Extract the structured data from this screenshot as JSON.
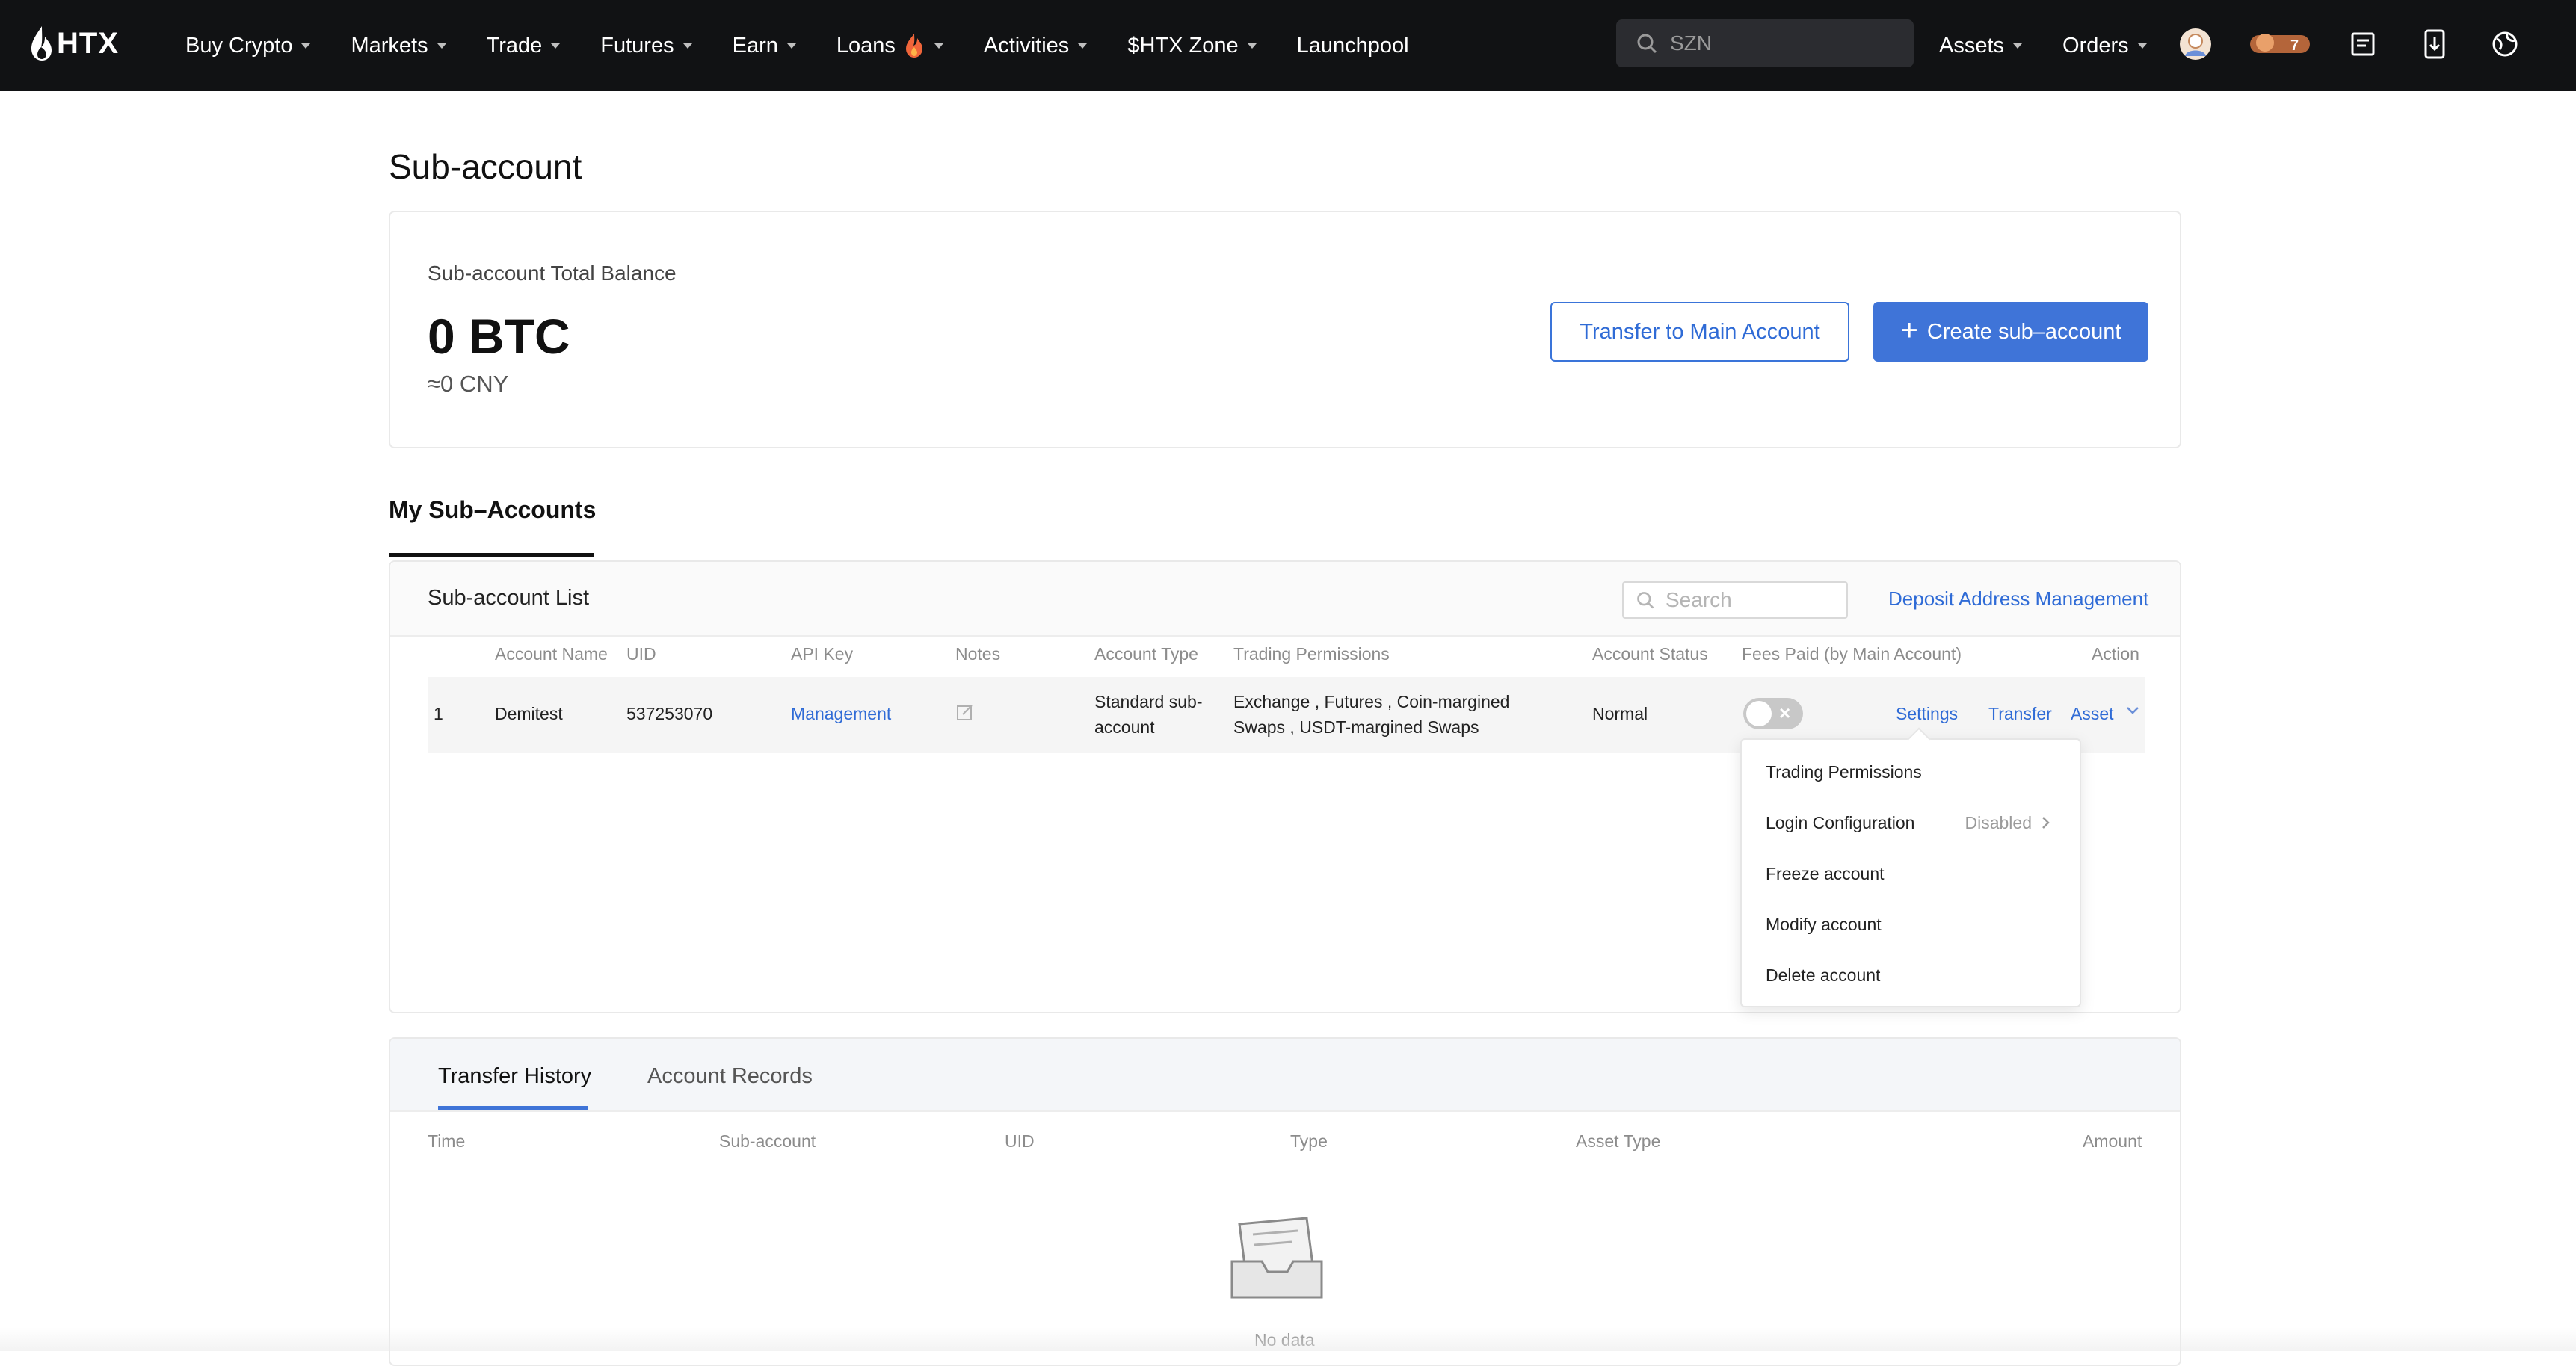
{
  "nav": {
    "brand": "HTX",
    "menu": [
      {
        "label": "Buy Crypto",
        "dropdown": true
      },
      {
        "label": "Markets",
        "dropdown": true
      },
      {
        "label": "Trade",
        "dropdown": true
      },
      {
        "label": "Futures",
        "dropdown": true
      },
      {
        "label": "Earn",
        "dropdown": true
      },
      {
        "label": "Loans",
        "dropdown": true,
        "icon": "flame-icon"
      },
      {
        "label": "Activities",
        "dropdown": true
      },
      {
        "label": "$HTX Zone",
        "dropdown": true
      },
      {
        "label": "Launchpool",
        "dropdown": false
      }
    ],
    "search_placeholder": "SZN",
    "assets_label": "Assets",
    "orders_label": "Orders",
    "badge_count": "7",
    "icons": [
      "avatar-icon",
      "badge-icon",
      "notes-icon",
      "download-icon",
      "language-icon"
    ]
  },
  "page": {
    "title": "Sub-account"
  },
  "balance": {
    "label": "Sub-account Total Balance",
    "value": "0 BTC",
    "approx": "≈0 CNY",
    "transfer_button": "Transfer to Main Account",
    "create_button": "Create sub–account"
  },
  "tabs": {
    "my_subaccounts": "My Sub–Accounts"
  },
  "list": {
    "title": "Sub-account List",
    "search_placeholder": "Search",
    "deposit_link": "Deposit Address Management",
    "columns": [
      "Account Name",
      "UID",
      "API Key",
      "Notes",
      "Account Type",
      "Trading Permissions",
      "Account Status",
      "Fees Paid (by Main Account)",
      "Action"
    ],
    "rows": [
      {
        "index": "1",
        "name": "Demitest",
        "uid": "537253070",
        "api_key": "Management",
        "account_type_line1": "Standard sub-",
        "account_type_line2": "account",
        "permissions_line1": "Exchange , Futures , Coin-margined",
        "permissions_line2": "Swaps , USDT-margined Swaps",
        "status": "Normal",
        "fees_toggle": false,
        "actions": {
          "settings": "Settings",
          "transfer": "Transfer",
          "asset": "Asset"
        }
      }
    ]
  },
  "settings_menu": {
    "items": [
      {
        "label": "Trading Permissions"
      },
      {
        "label": "Login Configuration",
        "status": "Disabled"
      },
      {
        "label": "Freeze account"
      },
      {
        "label": "Modify account"
      },
      {
        "label": "Delete account"
      }
    ]
  },
  "history": {
    "tabs": [
      "Transfer History",
      "Account Records"
    ],
    "active_tab": "Transfer History",
    "columns": [
      "Time",
      "Sub-account",
      "UID",
      "Type",
      "Asset Type",
      "Amount"
    ],
    "empty_text": "No data"
  },
  "colors": {
    "nav_bg": "#111214",
    "accent": "#3f74d8",
    "link": "#2f6bd6"
  }
}
